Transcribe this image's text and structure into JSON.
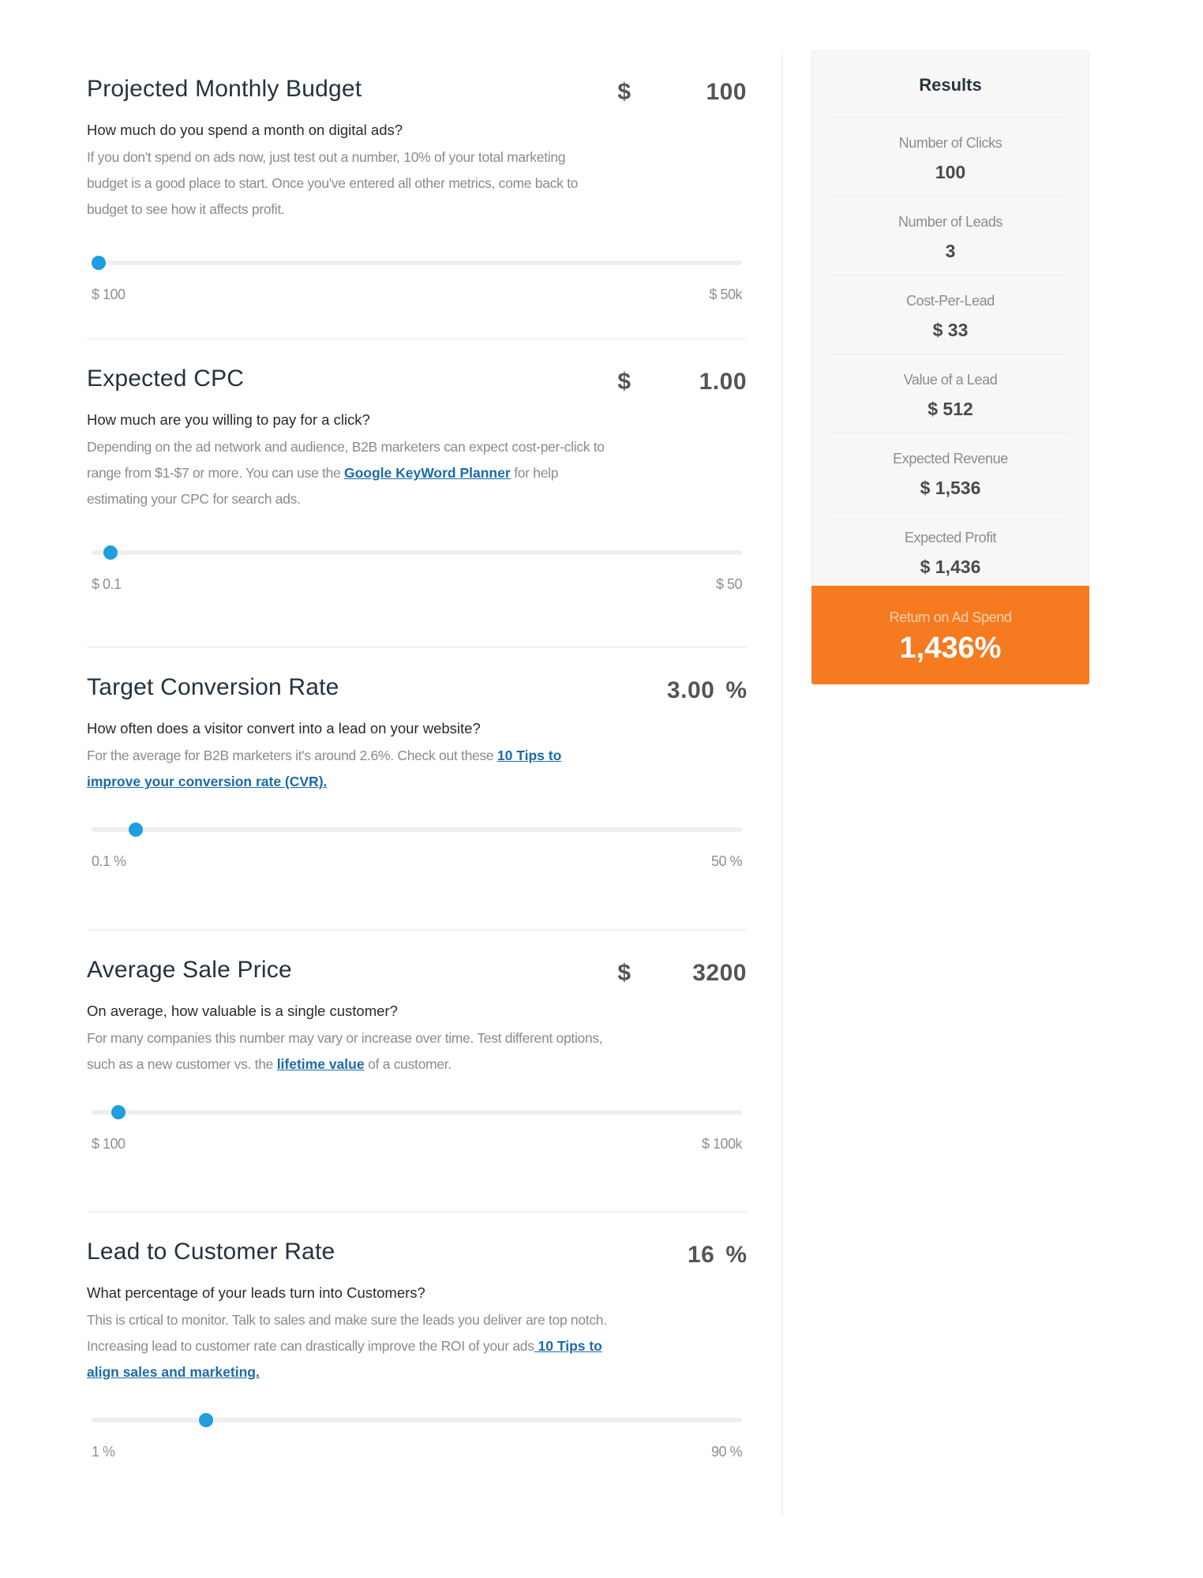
{
  "inputs": [
    {
      "title": "Projected Monthly Budget",
      "currency": "$",
      "value": "100",
      "suffix": "",
      "question": "How much do you spend a month on digital ads?",
      "description": [
        {
          "text": "If you don't spend on ads now, just test out a number, 10% of your total marketing budget is a good place to start. Once you've entered all other metrics, come back to budget to see how it affects profit."
        }
      ],
      "slider": {
        "min_label": "$ 100",
        "max_label": "$ 50k",
        "fraction": 0.0
      }
    },
    {
      "title": "Expected CPC",
      "currency": "$",
      "value": "1.00",
      "suffix": "",
      "question": "How much are you willing to pay for a click?",
      "description": [
        {
          "text": "Depending on the ad network and audience, B2B marketers can expect cost-per-click to range from $1-$7 or more. You can use the "
        },
        {
          "link": "Google KeyWord Planner"
        },
        {
          "text": " for help estimating your CPC for search ads."
        }
      ],
      "slider": {
        "min_label": "$ 0.1",
        "max_label": "$ 50",
        "fraction": 0.018
      }
    },
    {
      "title": "Target Conversion Rate",
      "currency": "",
      "value": "3.00",
      "suffix": "%",
      "question": "How often does a visitor convert into a lead on your website?",
      "description": [
        {
          "text": "For the average for B2B marketers it's around 2.6%. Check out these "
        },
        {
          "link": "10 Tips to improve your conversion rate (CVR)."
        }
      ],
      "slider": {
        "min_label": "0.1 %",
        "max_label": "50 %",
        "fraction": 0.058
      }
    },
    {
      "title": "Average Sale Price",
      "currency": "$",
      "value": "3200",
      "suffix": "",
      "question": "On average, how valuable is a single customer?",
      "description": [
        {
          "text": "For many companies this number may vary or increase over time. Test different options, such as a new customer vs. the "
        },
        {
          "link": "lifetime value"
        },
        {
          "text": " of a customer."
        }
      ],
      "slider": {
        "min_label": "$ 100",
        "max_label": "$ 100k",
        "fraction": 0.031
      }
    },
    {
      "title": "Lead to Customer Rate",
      "currency": "",
      "value": "16",
      "suffix": "%",
      "question": "What percentage of your leads turn into Customers?",
      "description": [
        {
          "text": "This is crtical to monitor. Talk to sales and make sure the leads you deliver are top notch. Increasing lead to customer rate can drastically improve the ROI of your ads"
        },
        {
          "link": " 10 Tips to align sales and marketing."
        }
      ],
      "slider": {
        "min_label": "1 %",
        "max_label": "90 %",
        "fraction": 0.169
      }
    }
  ],
  "results": {
    "title": "Results",
    "items": [
      {
        "label": "Number of Clicks",
        "value": "100"
      },
      {
        "label": "Number of Leads",
        "value": "3"
      },
      {
        "label": "Cost-Per-Lead",
        "value": "$ 33"
      },
      {
        "label": "Value of a Lead",
        "value": "$ 512"
      },
      {
        "label": "Expected Revenue",
        "value": "$ 1,536"
      },
      {
        "label": "Expected Profit",
        "value": "$ 1,436"
      }
    ],
    "roas": {
      "label": "Return on Ad Spend",
      "value": "1,436%"
    }
  },
  "colors": {
    "accent": "#1e9ee0",
    "roas_background": "#f57a20",
    "link": "#1c6ba8",
    "title": "#24323f"
  }
}
